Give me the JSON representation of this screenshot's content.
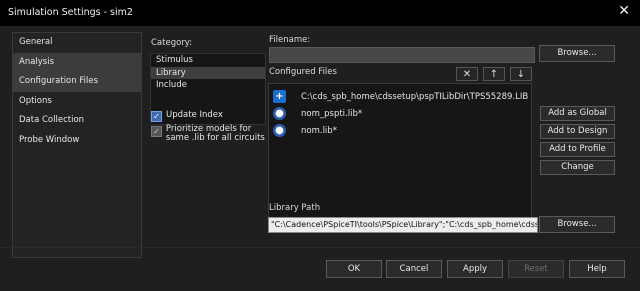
{
  "window": {
    "title": "Simulation Settings - sim2",
    "close_glyph": "✕"
  },
  "nav": {
    "items": [
      {
        "label": "General",
        "active": false
      },
      {
        "label": "Analysis",
        "active": true
      },
      {
        "label": "Configuration Files",
        "active": true
      },
      {
        "label": "Options",
        "active": false
      },
      {
        "label": "Data Collection",
        "active": false
      },
      {
        "label": "Probe Window",
        "active": false
      }
    ]
  },
  "category": {
    "label": "Category:",
    "items": [
      {
        "label": "Stimulus",
        "selected": false
      },
      {
        "label": "Library",
        "selected": true
      },
      {
        "label": "Include",
        "selected": false
      }
    ]
  },
  "options": {
    "update_index": {
      "label": "Update Index",
      "checked": true
    },
    "prioritize": {
      "label": "Prioritize models for same .lib for all circuits",
      "checked": true
    }
  },
  "filename": {
    "label": "Filename:",
    "value": "",
    "browse_label": "Browse..."
  },
  "configured": {
    "label": "Configured Files",
    "icons": [
      "delete-icon",
      "move-up-icon",
      "move-down-icon"
    ],
    "files": [
      {
        "name": "C:\\cds_spb_home\\cdssetup\\pspTILibDir\\TPS55289.LIB",
        "icon": "plus-icon"
      },
      {
        "name": "nom_pspti.lib*",
        "icon": "globe-icon"
      },
      {
        "name": "nom.lib*",
        "icon": "globe-icon"
      }
    ]
  },
  "side_buttons": {
    "add_global": "Add as Global",
    "add_design": "Add to Design",
    "add_profile": "Add to Profile",
    "change": "Change"
  },
  "library_path": {
    "label": "Library Path",
    "value": "\"C:\\Cadence\\PSpiceTI\\tools\\PSpice\\Library\";\"C:\\cds_spb_home\\cdssetup",
    "browse_label": "Browse..."
  },
  "footer": {
    "ok": "OK",
    "cancel": "Cancel",
    "apply": "Apply",
    "reset": "Reset",
    "help": "Help"
  }
}
